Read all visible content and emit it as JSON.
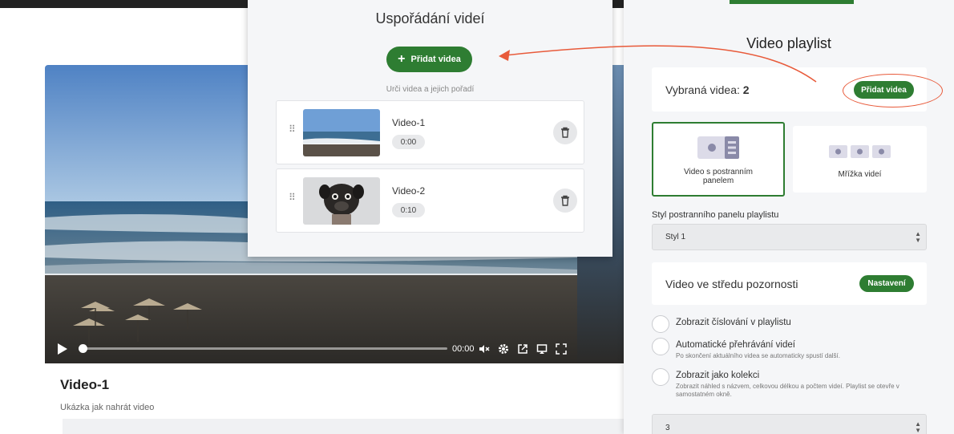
{
  "background": {
    "video_title": "Video-1",
    "video_description": "Ukázka jak nahrát video",
    "player_time": "00:00"
  },
  "modal": {
    "title": "Uspořádání videí",
    "add_button": "Přidat videa",
    "hint": "Urči videa a jejich pořadí",
    "videos": [
      {
        "name": "Video-1",
        "duration": "0:00"
      },
      {
        "name": "Video-2",
        "duration": "0:10"
      }
    ]
  },
  "panel": {
    "title": "Video playlist",
    "selected_label": "Vybraná videa:",
    "selected_count": "2",
    "add_button": "Přidat videa",
    "layouts": [
      {
        "label": "Video s postranním panelem",
        "selected": true
      },
      {
        "label": "Mřížka videí",
        "selected": false
      }
    ],
    "sidebar_style_label": "Styl postranního panelu playlistu",
    "sidebar_style_value": "Styl 1",
    "focus_label": "Video ve středu pozornosti",
    "focus_button": "Nastavení",
    "options": [
      {
        "title": "Zobrazit číslování v playlistu",
        "desc": ""
      },
      {
        "title": "Automatické přehrávání videí",
        "desc": "Po skončení aktuálního videa se automaticky spustí další."
      },
      {
        "title": "Zobrazit jako kolekci",
        "desc": "Zobrazit náhled s názvem, celkovou délkou a počtem videí. Playlist se otevře v samostatném okně."
      }
    ],
    "columns_value": "3"
  },
  "colors": {
    "accent": "#2e7d32",
    "annotation": "#e85a3a"
  },
  "icons": [
    "play-icon",
    "mute-icon",
    "gear-icon",
    "popout-icon",
    "cast-icon",
    "fullscreen-icon",
    "plus-icon",
    "drag-handle-icon",
    "trash-icon"
  ]
}
